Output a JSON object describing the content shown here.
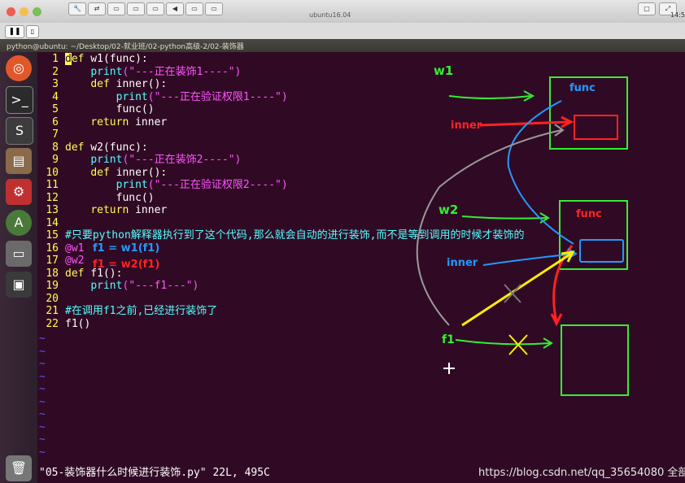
{
  "vm_window": {
    "title": "ubuntu16.04",
    "clock": "14:5"
  },
  "terminal": {
    "title": "python@ubuntu: ~/Desktop/02-就业班/02-python高级-2/02-装饰器"
  },
  "editor": {
    "lines": [
      {
        "n": "1",
        "kw": "def",
        "rest": " w1(func):"
      },
      {
        "n": "2",
        "indent": "    ",
        "fn": "print",
        "str": "(\"---正在装饰1----\")"
      },
      {
        "n": "3",
        "indent": "    ",
        "kw": "def",
        "rest": " inner():"
      },
      {
        "n": "4",
        "indent": "        ",
        "fn": "print",
        "str": "(\"---正在验证权限1----\")"
      },
      {
        "n": "5",
        "indent": "        ",
        "rest": "func()"
      },
      {
        "n": "6",
        "indent": "    ",
        "kw": "return",
        "rest": " inner"
      },
      {
        "n": "7"
      },
      {
        "n": "8",
        "kw": "def",
        "rest": " w2(func):"
      },
      {
        "n": "9",
        "indent": "    ",
        "fn": "print",
        "str": "(\"---正在装饰2----\")"
      },
      {
        "n": "10",
        "indent": "    ",
        "kw": "def",
        "rest": " inner():"
      },
      {
        "n": "11",
        "indent": "        ",
        "fn": "print",
        "str": "(\"---正在验证权限2----\")"
      },
      {
        "n": "12",
        "indent": "        ",
        "rest": "func()"
      },
      {
        "n": "13",
        "indent": "    ",
        "kw": "return",
        "rest": " inner"
      },
      {
        "n": "14"
      },
      {
        "n": "15",
        "cmt": "#只要python解释器执行到了这个代码,那么就会自动的进行装饰,而不是等到调用的时候才装饰的"
      },
      {
        "n": "16",
        "dec": "@w1"
      },
      {
        "n": "17",
        "dec": "@w2"
      },
      {
        "n": "18",
        "kw": "def",
        "rest": " f1():"
      },
      {
        "n": "19",
        "indent": "    ",
        "fn": "print",
        "str": "(\"---f1---\")"
      },
      {
        "n": "20"
      },
      {
        "n": "21",
        "cmt": "#在调用f1之前,已经进行装饰了"
      },
      {
        "n": "22",
        "rest": "f1()"
      }
    ],
    "tilde": "~",
    "status": "\"05-装饰器什么时候进行装饰.py\" 22L, 495C"
  },
  "annotations": {
    "w1": "w1",
    "w2": "w2",
    "func_top": "func",
    "func_mid": "func",
    "inner_red": "inner",
    "inner_blue": "inner",
    "f1": "f1",
    "f1_w1": "f1 = w1(f1)",
    "f1_w2": "f1 = w2(f1)"
  },
  "watermark": "https://blog.csdn.net/qq_35654080",
  "watermark_tail": "全部",
  "colors": {
    "terminal_bg": "#300a24",
    "keyword": "#ffff55",
    "string": "#ff55ff",
    "comment": "#55ffff",
    "green": "#33ee33",
    "red": "#ff2222",
    "blue": "#2299ff",
    "yellow": "#ffee00"
  }
}
